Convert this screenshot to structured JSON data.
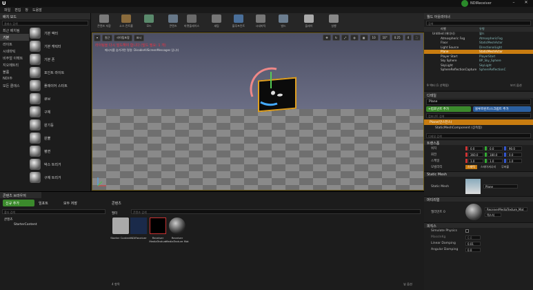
{
  "window": {
    "title_right": "NDIReceiver"
  },
  "menu": [
    "파일",
    "편집",
    "창",
    "도움말"
  ],
  "toolbar": [
    {
      "label": "콘텐츠 저장",
      "icon": "save-icon",
      "color": "#7a7a7a"
    },
    {
      "label": "소스 컨트롤",
      "icon": "source-control-icon",
      "color": "#8a6b3c"
    },
    {
      "label": "모드",
      "icon": "modes-icon",
      "color": "#5a8a6c"
    },
    {
      "label": "콘텐츠",
      "icon": "content-icon",
      "color": "#667788"
    },
    {
      "label": "마켓플레이스",
      "icon": "marketplace-icon",
      "color": "#6a6a6a"
    },
    {
      "label": "세팅",
      "icon": "settings-icon",
      "color": "#777"
    },
    {
      "label": "블루프린트",
      "icon": "blueprint-icon",
      "color": "#4a6f9a"
    },
    {
      "label": "시네마틱",
      "icon": "cinematics-icon",
      "color": "#777"
    },
    {
      "label": "빌드",
      "icon": "build-icon",
      "color": "#6b7d8f"
    },
    {
      "label": "플레이",
      "icon": "play-icon",
      "color": "#aaa"
    },
    {
      "label": "실행",
      "icon": "launch-icon",
      "color": "#888"
    }
  ],
  "modes": {
    "tab": "배치 모드",
    "search_placeholder": "클래스 검색",
    "categories": [
      "최근 배치됨",
      "기본",
      "라이트",
      "시네마틱",
      "비주얼 이펙트",
      "지오메트리",
      "볼륨",
      "NDI®",
      "모든 클래스"
    ],
    "selected_category": 1,
    "items": [
      "기본 액터",
      "기본 캐릭터",
      "기본 폰",
      "포인트 라이트",
      "플레이어 스타트",
      "큐브",
      "구체",
      "원기둥",
      "원뿔",
      "평면",
      "박스 트리거",
      "구체 트리거"
    ]
  },
  "viewport": {
    "perspective": "원근",
    "lit": "라이팅포함",
    "show": "표시",
    "warning": "라이팅을 다시 빌드해야 합니다 (빌드 필요: 1 개)",
    "hint": "메시지를 숨기려면 명령: DisableAllScreenMessages 입니다",
    "snap_values": [
      "10",
      "10°",
      "0.25",
      "4"
    ]
  },
  "outliner": {
    "tab": "월드 아웃라이너",
    "search_placeholder": "검색",
    "col_label": "라벨",
    "col_type": "유형",
    "rows": [
      {
        "name": "Untitled (에디터)",
        "type": "월드"
      },
      {
        "name": "Atmospheric Fog",
        "type": "AtmosphericFog"
      },
      {
        "name": "Floor",
        "type": "StaticMeshActor"
      },
      {
        "name": "Light Source",
        "type": "DirectionalLight"
      },
      {
        "name": "Plane",
        "type": "StaticMeshActor",
        "selected": true
      },
      {
        "name": "Player Start",
        "type": "PlayerStart"
      },
      {
        "name": "Sky Sphere",
        "type": "BP_Sky_Sphere"
      },
      {
        "name": "SkyLight",
        "type": "SkyLight"
      },
      {
        "name": "SphereReflectionCapture",
        "type": "SphereReflectionC"
      }
    ],
    "footer": "9 액터 (1 선택됨)",
    "view_options": "보기 옵션"
  },
  "details": {
    "tab": "디테일",
    "name_value": "Plane",
    "add_component": "+컴포넌트 추가",
    "blueprint_button": "블루프린트/스크립트 추가",
    "components_search": "컴포넌트 검색",
    "root_component": "Plane(인스턴스)",
    "child_component": "StaticMeshComponent (상속됨)",
    "details_search": "디테일 검색",
    "transform_section": "트랜스폼",
    "location_label": "위치",
    "rotation_label": "회전",
    "scale_label": "스케일",
    "mobility_label": "모빌리티",
    "location": [
      "0.0",
      "0.0",
      "90.0"
    ],
    "rotation": [
      "360.0",
      "180.0",
      "0.0"
    ],
    "scale": [
      "1.0",
      "1.0",
      "1.0"
    ],
    "mobility": [
      "스태틱",
      "스테이셔너리",
      "무버블"
    ],
    "static_mesh_section": "Static Mesh",
    "static_mesh_label": "Static Mesh",
    "static_mesh_value": "Plane",
    "materials_section": "머티리얼",
    "element_label": "엘리먼트 0",
    "material_value": "ReceiverMediaTexture_Mat",
    "textures_button": "텍스처",
    "physics_section": "피직스",
    "simulate_physics": "Simulate Physics",
    "mass_kg": "MassInKg",
    "mass_value": "0.0",
    "linear_damping": "Linear Damping",
    "linear_damping_value": "0.01",
    "angular_damping": "Angular Damping",
    "angular_damping_value": "0.0"
  },
  "content_browser": {
    "tab": "콘텐츠 브라우저",
    "add_new": "신규 추가",
    "import": "임포트",
    "save_all": "모두 저장",
    "path": "콘텐츠",
    "tree_search": "폴더 검색",
    "tree_root": "콘텐츠",
    "tree_child": "StarterContent",
    "filter": "필터",
    "asset_search": "콘텐츠 검색",
    "assets": [
      {
        "name": "Starter Content",
        "kind": "folder"
      },
      {
        "name": "NDIReceiver",
        "kind": "ndi"
      },
      {
        "name": "Receiver MediaTexture",
        "kind": "texture"
      },
      {
        "name": "Receiver MediaTexture Mat",
        "kind": "material"
      }
    ],
    "item_count": "4 항목",
    "view_options": "뷰 옵션"
  },
  "colors": {
    "accent": "#c87c10",
    "selection_border": "#e0a020",
    "add_green": "#3b8a2c",
    "blueprint_blue": "#2a5fa0"
  }
}
